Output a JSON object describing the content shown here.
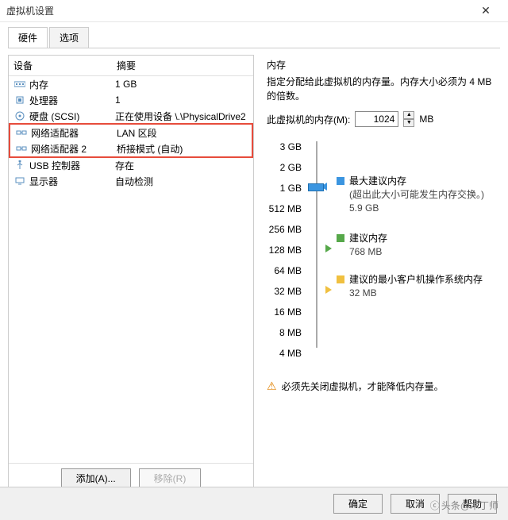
{
  "window": {
    "title": "虚拟机设置"
  },
  "tabs": {
    "hardware": "硬件",
    "options": "选项"
  },
  "list": {
    "col_device": "设备",
    "col_summary": "摘要",
    "rows": [
      {
        "name": "内存",
        "summary": "1 GB",
        "key": "memory"
      },
      {
        "name": "处理器",
        "summary": "1",
        "key": "cpu"
      },
      {
        "name": "硬盘 (SCSI)",
        "summary": "正在使用设备 \\.\\PhysicalDrive2",
        "key": "disk"
      },
      {
        "name": "网络适配器",
        "summary": "LAN 区段",
        "key": "net1"
      },
      {
        "name": "网络适配器 2",
        "summary": "桥接模式 (自动)",
        "key": "net2"
      },
      {
        "name": "USB 控制器",
        "summary": "存在",
        "key": "usb"
      },
      {
        "name": "显示器",
        "summary": "自动检测",
        "key": "display"
      }
    ],
    "add_btn": "添加(A)...",
    "remove_btn": "移除(R)"
  },
  "memory": {
    "section_title": "内存",
    "desc": "指定分配给此虚拟机的内存量。内存大小必须为 4 MB 的倍数。",
    "label": "此虚拟机的内存(M):",
    "value": "1024",
    "unit": "MB",
    "ticks": [
      "3 GB",
      "2 GB",
      "1 GB",
      "512 MB",
      "256 MB",
      "128 MB",
      "64 MB",
      "32 MB",
      "16 MB",
      "8 MB",
      "4 MB"
    ],
    "legend": {
      "max": {
        "title": "最大建议内存",
        "sub1": "(超出此大小可能发生内存交换。)",
        "sub2": "5.9 GB"
      },
      "rec": {
        "title": "建议内存",
        "sub": "768 MB"
      },
      "min": {
        "title": "建议的最小客户机操作系统内存",
        "sub": "32 MB"
      }
    },
    "warning": "必须先关闭虚拟机，才能降低内存量。"
  },
  "footer": {
    "ok": "确定",
    "cancel": "取消",
    "help": "帮助"
  },
  "watermark": "头条@木丁师"
}
